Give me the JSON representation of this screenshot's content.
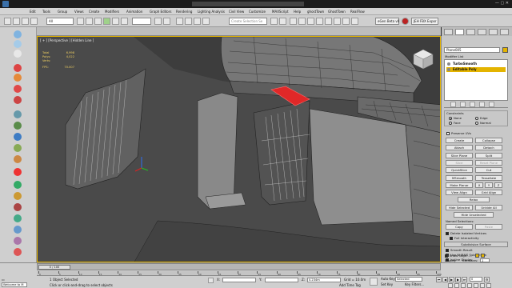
{
  "colors": {
    "accent": "#e4b400",
    "viewport_bg": "#4d4d4d",
    "selection": "#e02828"
  },
  "menu": [
    "Edit",
    "Tools",
    "Group",
    "Views",
    "Create",
    "Modifiers",
    "Animation",
    "Graph Editors",
    "Rendering",
    "Lighting Analysis",
    "Civil View",
    "Customize",
    "MAXScript",
    "Help",
    "ghostTown",
    "GhostTown",
    "RealFlow"
  ],
  "toolbar": {
    "filter": "All",
    "selection_set": "Create Selection Se",
    "plugin_label": "eGen Beta v0",
    "fbx_label": "JEH FBX Expor"
  },
  "viewport": {
    "label": "[ + ] [Perspective ] [Hidden Line ]",
    "stats": [
      {
        "name": "Total",
        "value": "6,998"
      },
      {
        "name": "Polys:",
        "value": "4,022"
      },
      {
        "name": "Verts:",
        "value": ""
      },
      {
        "name": "FPS:",
        "value": "70.007"
      }
    ]
  },
  "cmdpanel": {
    "object_name": "Plane005",
    "modifier_list": "Modifier List",
    "stack": [
      "TurboSmooth",
      "Editable Poly"
    ],
    "constraints": {
      "title": "Constraints",
      "options": [
        "None",
        "Edge",
        "Face",
        "Normal"
      ],
      "selected": "None"
    },
    "preserve_uvs": "Preserve UVs",
    "buttons": {
      "create": "Create",
      "collapse": "Collapse",
      "attach": "Attach",
      "detach": "Detach",
      "slice_plane": "Slice Plane",
      "split": "Split",
      "slice": "Slice",
      "reset_plane": "Reset Plane",
      "quickslice": "QuickSlice",
      "cut": "Cut",
      "msmooth": "MSmooth",
      "tessellate": "Tessellate",
      "make_planar": "Make Planar",
      "x": "X",
      "y": "Y",
      "z": "Z",
      "view_align": "View Align",
      "grid_align": "Grid Align",
      "relax": "Relax",
      "hide_selected": "Hide Selected",
      "unhide_all": "Unhide All",
      "hide_unselected": "Hide Unselected",
      "named_selections": "Named Selections:",
      "copy": "Copy",
      "paste": "Paste",
      "delete_isolated": "Delete Isolated Vertices",
      "full_interactivity": "Full Interactivity",
      "subdivision_surface": "Subdivision Surface",
      "smooth_result": "Smooth Result",
      "use_nurms": "Use NURMS Subdivision",
      "isoline": "Isoline Display",
      "show_cage": "Show Cage......",
      "display": "Display",
      "iterations_label": "Iterations:",
      "iterations": "1"
    }
  },
  "timeline": {
    "slider": "0 / 100",
    "ticks": [
      "0",
      "5",
      "10",
      "15",
      "20",
      "25",
      "30",
      "35",
      "40",
      "45",
      "50",
      "55",
      "60",
      "65",
      "70",
      "75",
      "80",
      "85",
      "90",
      "95",
      "100"
    ]
  },
  "status": {
    "welcome": "Welcome to M",
    "objects": "1 Object Selected",
    "hint": "Click or click-and-drag to select objects",
    "x_label": "X:",
    "x_val": "",
    "y_label": "Y:",
    "z_label": "Z:",
    "z_val": "0.234m",
    "grid": "Grid = 10.0m",
    "auto_key": "Auto Key",
    "selected": "Selected",
    "set_key": "Set Key",
    "key_filters": "Key Filters...",
    "add_time_tag": "Add Time Tag",
    "frame": "0"
  }
}
